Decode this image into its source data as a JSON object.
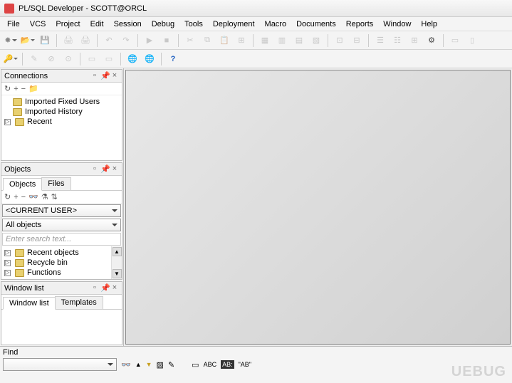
{
  "title": "PL/SQL Developer - SCOTT@ORCL",
  "menu": [
    "File",
    "VCS",
    "Project",
    "Edit",
    "Session",
    "Debug",
    "Tools",
    "Deployment",
    "Macro",
    "Documents",
    "Reports",
    "Window",
    "Help"
  ],
  "connections": {
    "title": "Connections",
    "items": [
      {
        "label": "Imported Fixed Users",
        "expandable": false
      },
      {
        "label": "Imported History",
        "expandable": false
      },
      {
        "label": "Recent",
        "expandable": true
      }
    ]
  },
  "objects": {
    "title": "Objects",
    "tabs": [
      "Objects",
      "Files"
    ],
    "user_combo": "<CURRENT USER>",
    "filter_combo": "All objects",
    "search_placeholder": "Enter search text...",
    "items": [
      {
        "label": "Recent objects"
      },
      {
        "label": "Recycle bin"
      },
      {
        "label": "Functions"
      }
    ]
  },
  "windowlist": {
    "title": "Window list",
    "tabs": [
      "Window list",
      "Templates"
    ]
  },
  "find": {
    "label": "Find",
    "btn_labels": {
      "abc": "ABC",
      "abc2": "AB:",
      "ab3": "\"AB\""
    }
  },
  "icons": {
    "refresh": "↻",
    "plus": "+",
    "minus": "−",
    "binoc": "🔍",
    "flash": "⚡",
    "help": "?",
    "new": "✸",
    "open": "📂",
    "save": "💾",
    "print": "🖨",
    "undo": "↶",
    "redo": "↷",
    "cut": "✂",
    "copy": "⧉",
    "paste": "📋",
    "exec": "▶",
    "stop": "■",
    "commit": "✓",
    "pin": "📌",
    "close": "×",
    "up": "▲",
    "down": "▼",
    "expand": "▷"
  },
  "watermark": "UEBUG"
}
